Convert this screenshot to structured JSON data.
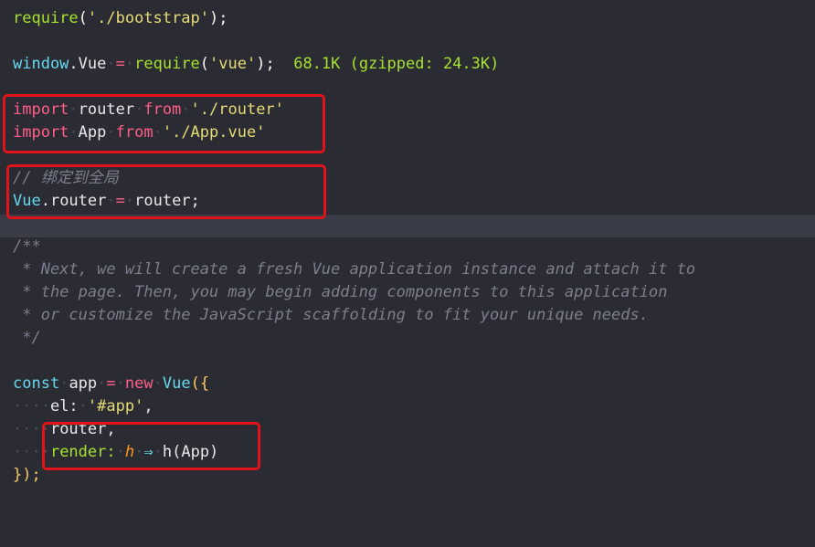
{
  "code": {
    "l1": {
      "fn": "require",
      "open": "(",
      "str": "'./bootstrap'",
      "close": ");"
    },
    "l3": {
      "obj": "window",
      "dot": ".",
      "prop": "Vue",
      "eq": "=",
      "fn": "require",
      "open": "(",
      "str": "'vue'",
      "close": ");",
      "size_label": "68.1K (gzipped: 24.3K)"
    },
    "l5": {
      "kw1": "import",
      "id": "router",
      "kw2": "from",
      "str": "'./router'"
    },
    "l6": {
      "kw1": "import",
      "id": "App",
      "kw2": "from",
      "str": "'./App.vue'"
    },
    "l8": {
      "comment": "// 绑定到全局"
    },
    "l9": {
      "obj": "Vue",
      "rest1": ".router",
      "eq": "=",
      "rest2": "router;"
    },
    "l11": {
      "comment": "/**"
    },
    "l12": {
      "comment": " * Next, we will create a fresh Vue application instance and attach it to"
    },
    "l13": {
      "comment": " * the page. Then, you may begin adding components to this application"
    },
    "l14": {
      "comment": " * or customize the JavaScript scaffolding to fit your unique needs."
    },
    "l15": {
      "comment": " */"
    },
    "l17": {
      "kw1": "const",
      "id": "app",
      "eq": "=",
      "kw2": "new",
      "cls": "Vue",
      "open": "({"
    },
    "l18": {
      "key": "el:",
      "str": "'#app'",
      "comma": ","
    },
    "l19": {
      "id": "router,"
    },
    "l20": {
      "key": "render:",
      "param": "h",
      "arrow": "⇒",
      "fn": "h",
      "args": "(App)"
    },
    "l21": {
      "close": "});"
    }
  },
  "colors": {
    "highlight_box": "#e0131b",
    "background": "#2b2b34"
  }
}
